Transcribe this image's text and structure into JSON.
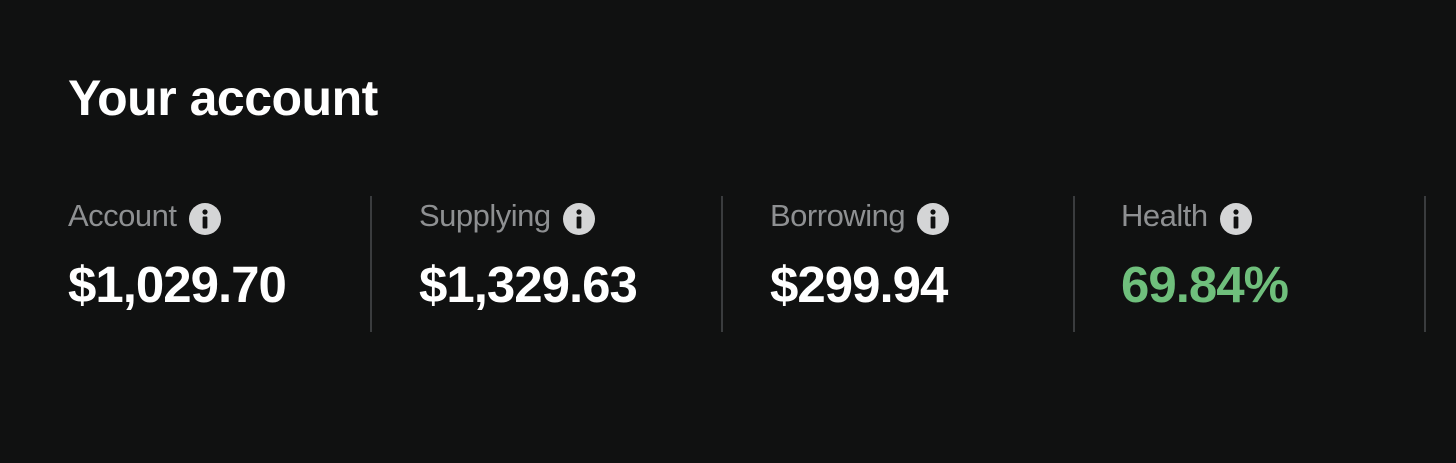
{
  "account_section": {
    "title": "Your account"
  },
  "stats": [
    {
      "label": "Account",
      "value": "$1,029.70",
      "icon": "info-icon"
    },
    {
      "label": "Supplying",
      "value": "$1,329.63",
      "icon": "info-icon"
    },
    {
      "label": "Borrowing",
      "value": "$299.94",
      "icon": "info-icon"
    },
    {
      "label": "Health",
      "value": "69.84%",
      "icon": "info-icon"
    }
  ],
  "colors": {
    "background": "#101111",
    "label": "#8e9092",
    "value": "#ffffff",
    "health": "#6fbf7c",
    "divider": "#3a3c3e"
  }
}
